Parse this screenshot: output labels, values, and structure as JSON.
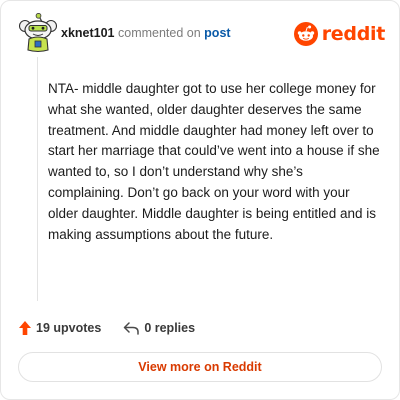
{
  "comment": {
    "username": "xknet101",
    "verb": "commented on",
    "target_link": "post",
    "avatar_icon": "snoo-avatar-icon",
    "body": "NTA- middle daughter got to use her college money for what she wanted, older daughter deserves the same treatment. And middle daughter had money left over to start her marriage that could’ve went into a house if she wanted to, so I don’t understand why she’s complaining. Don’t go back on your word with your older daughter. Middle daughter is being entitled and is making assumptions about the future."
  },
  "brand": {
    "name": "reddit",
    "icon": "reddit-logo-icon",
    "color": "#ff4500"
  },
  "actions": {
    "upvotes_label": "19 upvotes",
    "upvote_icon": "upvote-arrow-icon",
    "upvote_color": "#ff4500",
    "replies_label": "0 replies",
    "reply_icon": "reply-arrow-icon"
  },
  "footer": {
    "view_more_label": "View more on Reddit",
    "link_color": "#d93a00"
  }
}
